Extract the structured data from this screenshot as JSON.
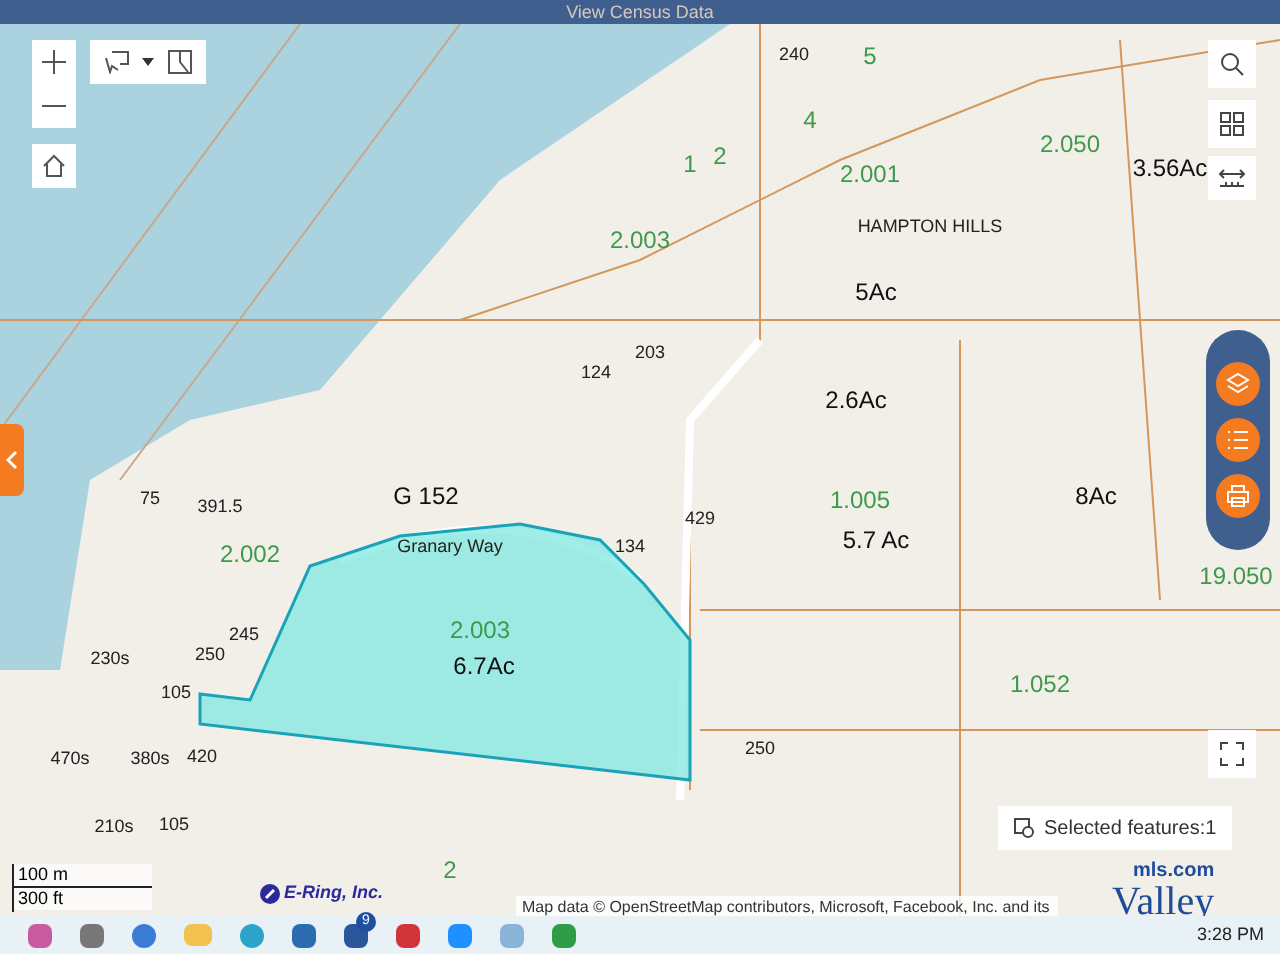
{
  "banner": {
    "title": "View Census Data"
  },
  "map": {
    "labels": [
      {
        "text": "240",
        "kind": "dim"
      },
      {
        "text": "5",
        "kind": "lot"
      },
      {
        "text": "4",
        "kind": "lot"
      },
      {
        "text": "1",
        "kind": "lot"
      },
      {
        "text": "2",
        "kind": "lot"
      },
      {
        "text": "2.001",
        "kind": "lot"
      },
      {
        "text": "2.050",
        "kind": "lot"
      },
      {
        "text": "3.56Ac",
        "kind": "area"
      },
      {
        "text": "HAMPTON HILLS",
        "kind": "dim"
      },
      {
        "text": "5Ac",
        "kind": "area"
      },
      {
        "text": "2.003",
        "kind": "lot"
      },
      {
        "text": "203",
        "kind": "dim"
      },
      {
        "text": "124",
        "kind": "dim"
      },
      {
        "text": "2.6Ac",
        "kind": "area"
      },
      {
        "text": "G 152",
        "kind": "area"
      },
      {
        "text": "391.5",
        "kind": "dim"
      },
      {
        "text": "75",
        "kind": "dim"
      },
      {
        "text": "1.005",
        "kind": "lot"
      },
      {
        "text": "8Ac",
        "kind": "area"
      },
      {
        "text": "5.7 Ac",
        "kind": "area"
      },
      {
        "text": "429",
        "kind": "dim"
      },
      {
        "text": "134",
        "kind": "dim"
      },
      {
        "text": "2.002",
        "kind": "lot"
      },
      {
        "text": "Granary Way",
        "kind": "dim"
      },
      {
        "text": "19.050",
        "kind": "lot"
      },
      {
        "text": "245",
        "kind": "dim"
      },
      {
        "text": "2.003",
        "kind": "lot"
      },
      {
        "text": "6.7Ac",
        "kind": "area"
      },
      {
        "text": "230s",
        "kind": "dim"
      },
      {
        "text": "250",
        "kind": "dim"
      },
      {
        "text": "105",
        "kind": "dim"
      },
      {
        "text": "1.052",
        "kind": "lot"
      },
      {
        "text": "470s",
        "kind": "dim"
      },
      {
        "text": "380s",
        "kind": "dim"
      },
      {
        "text": "420",
        "kind": "dim"
      },
      {
        "text": "250",
        "kind": "dim"
      },
      {
        "text": "210s",
        "kind": "dim"
      },
      {
        "text": "105",
        "kind": "dim"
      },
      {
        "text": "2",
        "kind": "lot"
      }
    ]
  },
  "selected_features": "Selected features:1",
  "attribution": "Map data © OpenStreetMap contributors, Microsoft, Facebook, Inc. and its",
  "scale": {
    "metric": "100 m",
    "imperial": "300 ft"
  },
  "branding": {
    "company": "E-Ring, Inc.",
    "logo_domain": "mls.com",
    "logo_word": "Valley"
  },
  "taskbar": {
    "badge": "9",
    "time": "3:28 PM"
  }
}
